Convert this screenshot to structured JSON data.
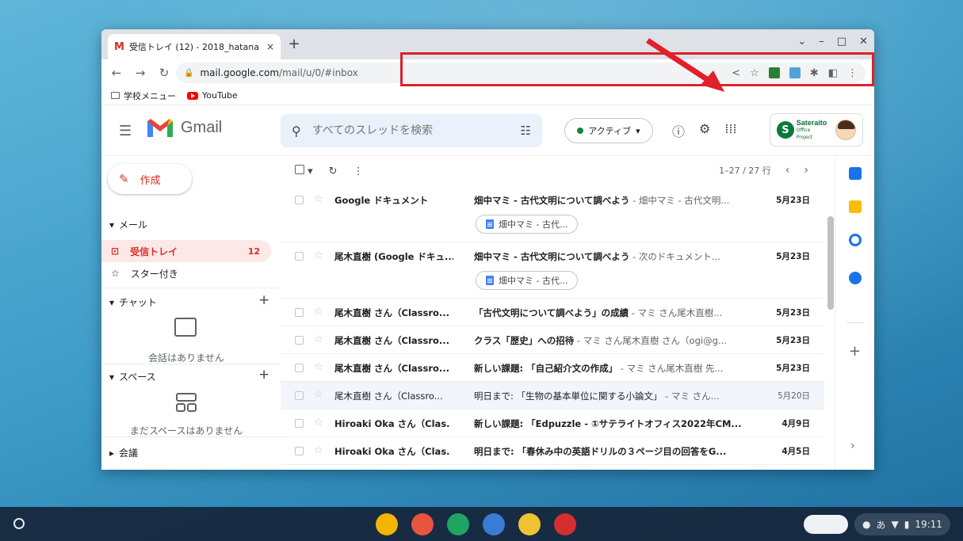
{
  "browser": {
    "tab_title": "受信トレイ (12) - 2018_hatana",
    "tab_favicon": "M",
    "tab_close": "×",
    "new_tab": "+",
    "window_controls": [
      "⌄",
      "–",
      "□",
      "✕"
    ],
    "url_host": "mail.google.com",
    "url_path": "/mail/u/0/#inbox",
    "bookmarks": [
      {
        "label": "学校メニュー",
        "icon": "folder-icon"
      },
      {
        "label": "YouTube",
        "icon": "youtube-icon"
      }
    ]
  },
  "gmail": {
    "app_name": "Gmail",
    "search_placeholder": "すべてのスレッドを検索",
    "status": "アクティブ",
    "status_color": "#188038",
    "org": {
      "name": "Sateraito",
      "sub": "Office Project"
    },
    "compose_label": "作成",
    "sections": {
      "mail": "メール",
      "chat": "チャット",
      "spaces": "スペース",
      "meet": "会議"
    },
    "nav": [
      {
        "label": "受信トレイ",
        "count": "12",
        "active": true
      },
      {
        "label": "スター付き",
        "count": "",
        "active": false
      }
    ],
    "chat_empty": "会話はありません",
    "spaces_empty": "まだスペースはありません",
    "pager": "1–27 / 27 行",
    "accent": "#d93025"
  },
  "emails": [
    {
      "sender": "Google ドキュメント",
      "subject": "畑中マミ - 古代文明について調べよう",
      "snippet": " - 畑中マミ - 古代文明...",
      "date": "5月23日",
      "unread": true,
      "chip": "畑中マミ - 古代..."
    },
    {
      "sender": "尾木直樹 (Google ドキュ...",
      "subject": "畑中マミ - 古代文明について調べよう",
      "snippet": " - 次のドキュメント...",
      "date": "5月23日",
      "unread": true,
      "chip": "畑中マミ - 古代..."
    },
    {
      "sender": "尾木直樹 さん（Classro...",
      "subject": "「古代文明について調べよう」の成績",
      "snippet": " - マミ さん尾木直樹...",
      "date": "5月23日",
      "unread": true,
      "chip": ""
    },
    {
      "sender": "尾木直樹 さん（Classro...",
      "subject": "クラス「歴史」への招待",
      "snippet": " - マミ さん尾木直樹 さん（ogi@g...",
      "date": "5月23日",
      "unread": true,
      "chip": ""
    },
    {
      "sender": "尾木直樹 さん（Classro...",
      "subject": "新しい課題: 「自己紹介文の作成」",
      "snippet": " - マミ さん尾木直樹 先...",
      "date": "5月23日",
      "unread": true,
      "chip": ""
    },
    {
      "sender": "尾木直樹 さん（Classro...",
      "subject": "明日まで: 「生物の基本単位に関する小論文」",
      "snippet": " - マミ さん...",
      "date": "5月20日",
      "unread": false,
      "chip": ""
    },
    {
      "sender": "Hiroaki Oka さん（Clas.",
      "subject": "新しい課題: 「Edpuzzle - ①サテライトオフィス2022年CM...",
      "snippet": "",
      "date": "4月9日",
      "unread": true,
      "chip": ""
    },
    {
      "sender": "Hiroaki Oka さん（Clas.",
      "subject": "明日まで: 「春休み中の英語ドリルの３ページ目の回答をG...",
      "snippet": "",
      "date": "4月5日",
      "unread": true,
      "chip": ""
    }
  ],
  "shelf": {
    "ime_label": "",
    "tray_ime": "あ",
    "time": "19:11",
    "apps": [
      {
        "name": "chrome-icon",
        "color": "#f4b400"
      },
      {
        "name": "app-cube-icon",
        "color": "#e8553e"
      },
      {
        "name": "drive-icon",
        "color": "#1fa463"
      },
      {
        "name": "ibis-paint-icon",
        "color": "#3a7bd5"
      },
      {
        "name": "app-window-icon",
        "color": "#f1c232"
      },
      {
        "name": "acrobat-icon",
        "color": "#d32f2f"
      }
    ]
  },
  "annotation": {
    "color": "#e0202a"
  }
}
